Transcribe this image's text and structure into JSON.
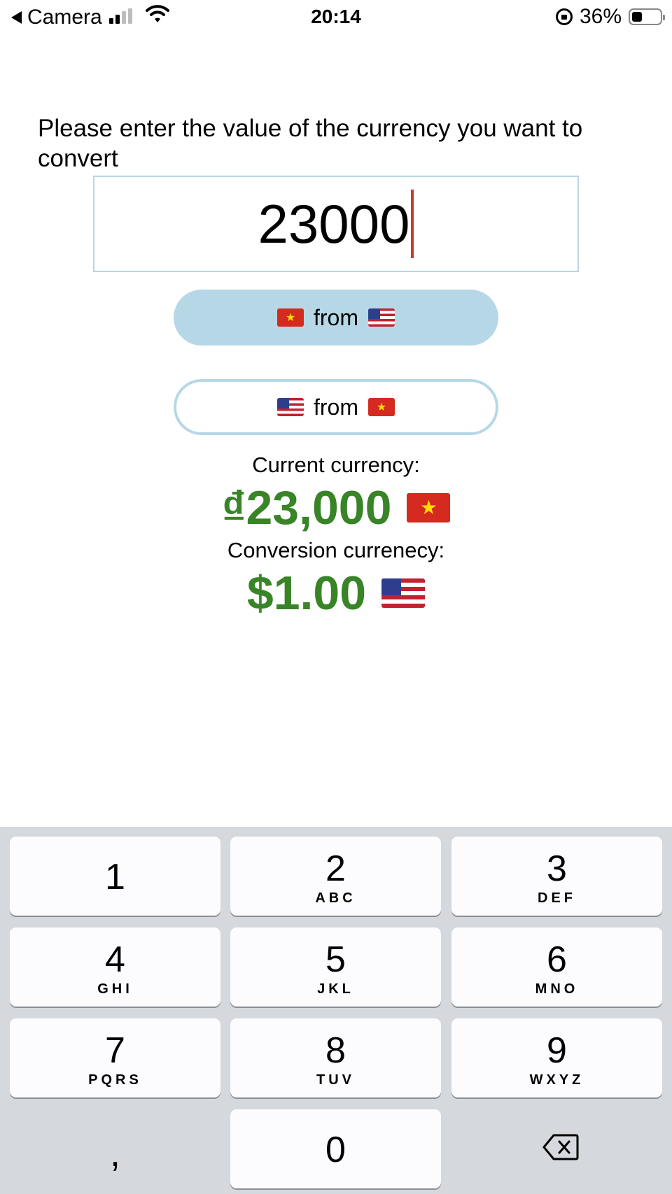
{
  "status_bar": {
    "back_label": "Camera",
    "time": "20:14",
    "battery_text": "36%",
    "battery_level": 0.36,
    "signal_bars_active": 2,
    "signal_bars_total": 4
  },
  "prompt": "Please enter the value of the currency you want to convert",
  "amount_input": {
    "value": "23000"
  },
  "buttons": {
    "vn_from_us": {
      "label": "from",
      "left_flag": "flag-vietnam",
      "right_flag": "flag-usa"
    },
    "us_from_vn": {
      "label": "from",
      "left_flag": "flag-usa",
      "right_flag": "flag-vietnam"
    }
  },
  "current": {
    "label": "Current currency:",
    "value": "₫23,000",
    "flag": "flag-vietnam"
  },
  "conversion": {
    "label": "Conversion currenecy:",
    "value": "$1.00",
    "flag": "flag-usa"
  },
  "keyboard": {
    "keys": [
      {
        "num": "1",
        "letters": ""
      },
      {
        "num": "2",
        "letters": "ABC"
      },
      {
        "num": "3",
        "letters": "DEF"
      },
      {
        "num": "4",
        "letters": "GHI"
      },
      {
        "num": "5",
        "letters": "JKL"
      },
      {
        "num": "6",
        "letters": "MNO"
      },
      {
        "num": "7",
        "letters": "PQRS"
      },
      {
        "num": "8",
        "letters": "TUV"
      },
      {
        "num": "9",
        "letters": "WXYZ"
      },
      {
        "num": "0",
        "letters": ""
      }
    ],
    "separator": ",",
    "delete_icon": "backspace-icon"
  },
  "colors": {
    "accent_blue": "#b6d8e6",
    "value_green": "#388427",
    "caret_red": "#d0382a",
    "keyboard_bg": "#d5d8dd"
  }
}
